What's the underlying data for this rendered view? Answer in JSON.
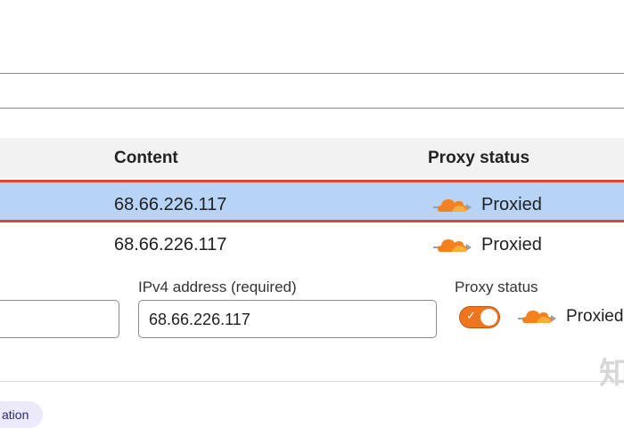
{
  "table": {
    "headers": {
      "content": "Content",
      "proxy_status": "Proxy status"
    },
    "rows": [
      {
        "content": "68.66.226.117",
        "proxy": "Proxied",
        "selected": true
      },
      {
        "content": "68.66.226.117",
        "proxy": "Proxied",
        "selected": false
      }
    ]
  },
  "edit_form": {
    "ipv4_label": "IPv4 address (required)",
    "ipv4_value": "68.66.226.117",
    "proxy_label": "Proxy status",
    "proxy_value": "Proxied",
    "proxy_enabled": true
  },
  "chip": {
    "label": "ation"
  },
  "watermark": "知",
  "colors": {
    "accent_orange": "#f0751f",
    "selection_blue": "#b7d3f6",
    "selection_border": "#e0472b",
    "chip_bg": "#ece9fb"
  },
  "icons": {
    "proxied": "orange-cloud-icon",
    "toggle_on": "check-icon"
  }
}
